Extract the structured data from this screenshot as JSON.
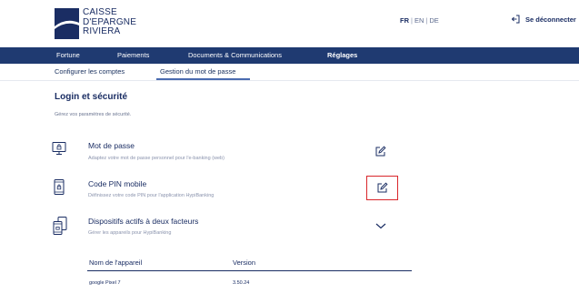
{
  "brand": {
    "line1": "CAISSE",
    "line2": "D'EPARGNE",
    "line3": "RIVIERA",
    "color": "#1a2d63"
  },
  "languages": {
    "active": "FR",
    "separator": "|",
    "options": [
      "EN",
      "DE"
    ]
  },
  "logout": {
    "label": "Se déconnecter",
    "icon": "logout-icon"
  },
  "nav": {
    "items": [
      "Fortune",
      "Paiements",
      "Documents & Communications",
      "Réglages"
    ],
    "active_index": 3,
    "background": "#1f3a71"
  },
  "subnav": {
    "items": [
      "Configurer les comptes",
      "Gestion du mot de passe"
    ],
    "active_index": 1
  },
  "section": {
    "title": "Login et sécurité",
    "subtitle": "Gérez vos paramètres de sécurité."
  },
  "settings": [
    {
      "title": "Mot de passe",
      "description": "Adaptez votre mot de passe personnel pour l'e-banking (web)",
      "icon": "password-lock-icon",
      "action_icon": "edit-icon"
    },
    {
      "title": "Code PIN mobile",
      "description": "Définissez votre code PIN pour l'application HypiBanking",
      "icon": "mobile-pin-icon",
      "action_icon": "edit-icon",
      "highlight_color": "#d9262b"
    },
    {
      "title": "Dispositifs actifs à deux facteurs",
      "description": "Gérer les appareils pour HypiBanking",
      "icon": "devices-icon",
      "action_icon": "chevron-down-icon"
    }
  ],
  "devices_table": {
    "headers": [
      "Nom de l'appareil",
      "Version"
    ],
    "rows": [
      [
        "google Pixel 7",
        "3.50.24"
      ]
    ]
  }
}
